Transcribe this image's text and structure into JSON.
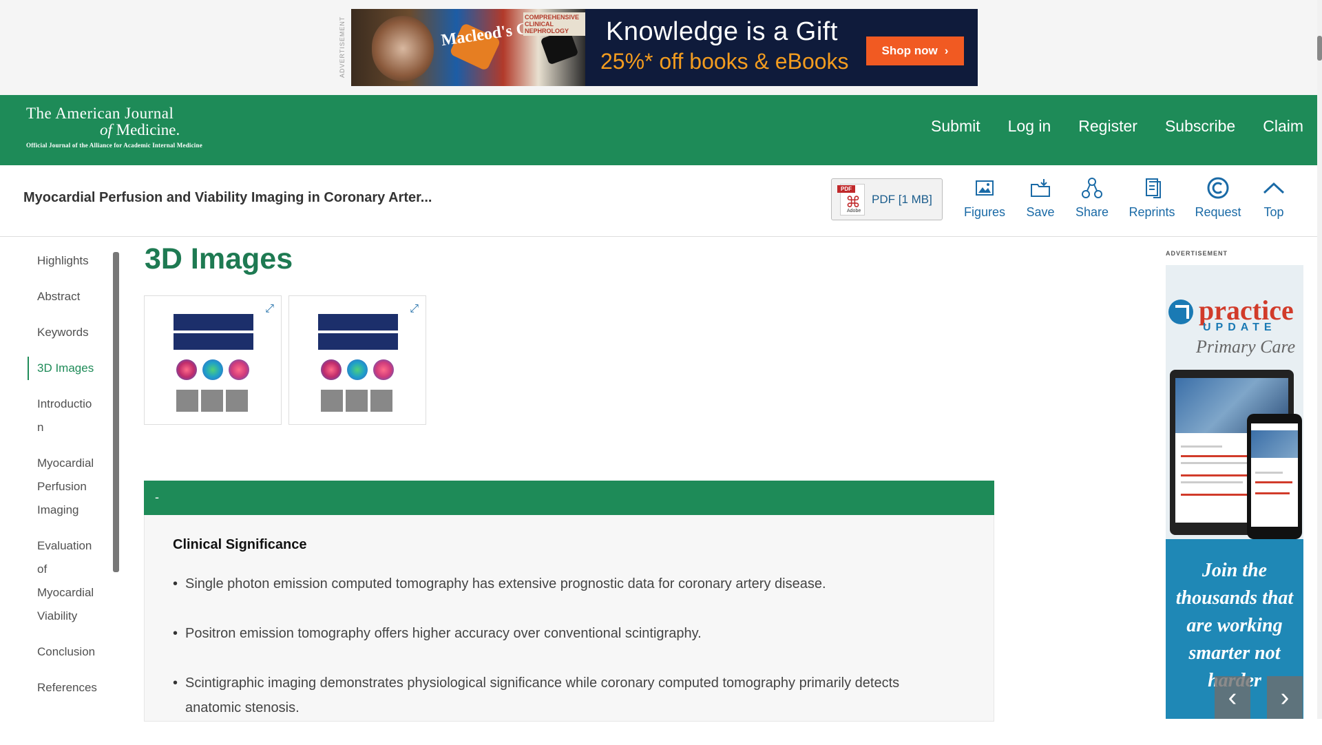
{
  "ad_top": {
    "label": "ADVERTISEMENT",
    "book_title": "Macleod's Clinical",
    "book_corner": "COMPREHENSIVE CLINICAL NEPHROLOGY",
    "headline": "Knowledge is a Gift",
    "subline": "25%* off books & eBooks",
    "cta": "Shop now"
  },
  "header": {
    "logo_line1": "The American Journal",
    "logo_of": "of",
    "logo_line2": "Medicine.",
    "logo_tagline": "Official Journal of the Alliance for Academic Internal Medicine",
    "nav": [
      "Submit",
      "Log in",
      "Register",
      "Subscribe",
      "Claim"
    ]
  },
  "toolbar": {
    "article_title": "Myocardial Perfusion and Viability Imaging in Coronary Arter...",
    "pdf_label": "PDF [1 MB]",
    "pdf_tag": "PDF",
    "pdf_brand": "Adobe",
    "tools": [
      "Figures",
      "Save",
      "Share",
      "Reprints",
      "Request",
      "Top"
    ]
  },
  "toc": {
    "items": [
      "Highlights",
      "Abstract",
      "Keywords",
      "3D Images",
      "Introductio\nn",
      "Myocardial\nPerfusion\nImaging",
      "Evaluation\nof\nMyocardial\nViability",
      "Conclusion",
      "References"
    ],
    "active_index": 3
  },
  "main": {
    "heading": "3D Images",
    "section_bar": "-",
    "clinical_title": "Clinical Significance",
    "bullets": [
      "Single photon emission computed tomography has extensive prognostic data for coronary artery disease.",
      "Positron emission tomography offers higher accuracy over conventional scintigraphy.",
      "Scintigraphic imaging demonstrates physiological significance while coronary computed tomography primarily detects anatomic stenosis."
    ]
  },
  "ad_right": {
    "label": "ADVERTISEMENT",
    "brand": "practice",
    "brand_sub": "UPDATE",
    "brand_area": "Primary Care",
    "tagline": "Join the thousands that are working smarter not harder"
  },
  "colors": {
    "brand_green": "#1e8b58",
    "link_blue": "#1a6aa6",
    "ad_orange": "#f15a22"
  }
}
